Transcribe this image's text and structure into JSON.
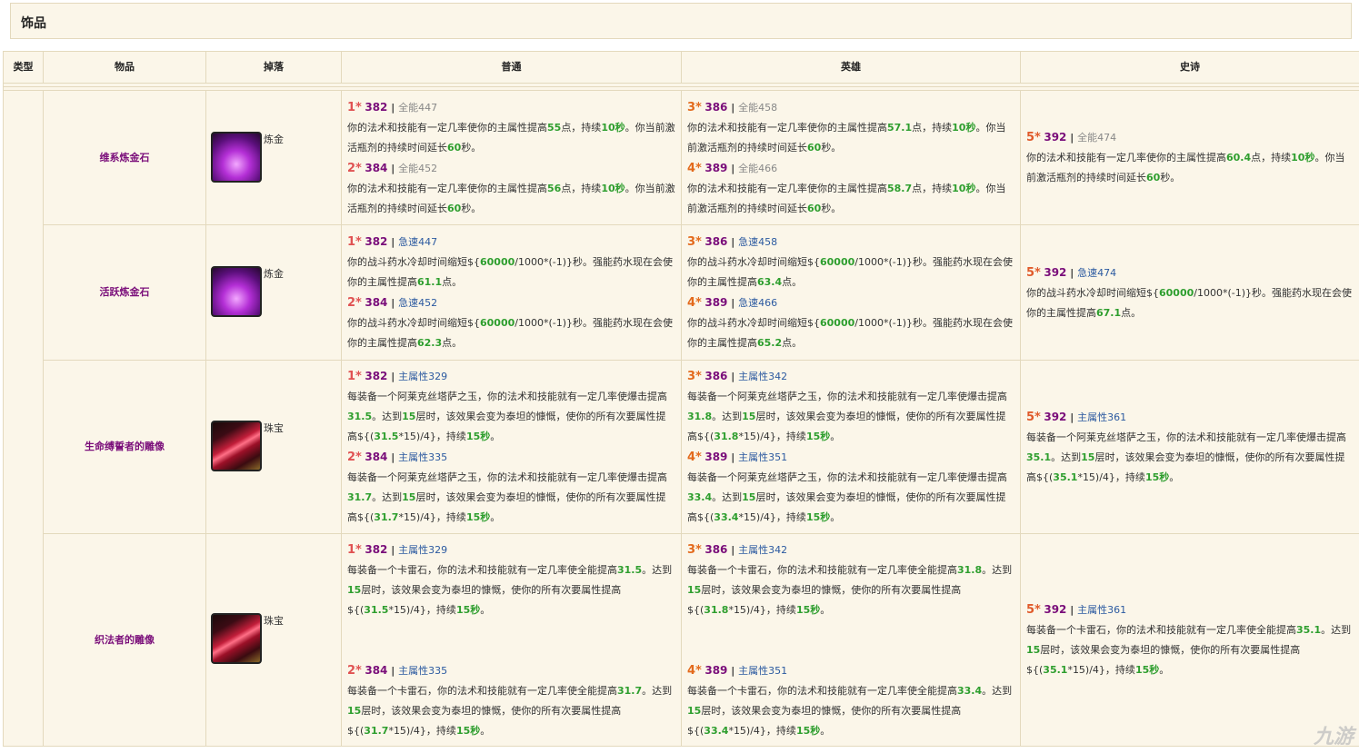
{
  "title": "饰品",
  "headers": [
    "类型",
    "物品",
    "掉落",
    "普通",
    "英雄",
    "史诗"
  ],
  "rows": [
    {
      "item": "维系炼金石",
      "icon": "purple-potion-icon",
      "drop": "炼金",
      "normal": [
        {
          "star": "1*",
          "ilvl": "382",
          "stat": "全能447",
          "desc": [
            "你的法术和技能有一定几率使你的主属性提高",
            "55",
            "点，持续",
            "10秒",
            "。你当前激活瓶剂的持续时间延长",
            "60",
            "秒。"
          ]
        },
        {
          "star": "2*",
          "ilvl": "384",
          "stat": "全能452",
          "desc": [
            "你的法术和技能有一定几率使你的主属性提高",
            "56",
            "点，持续",
            "10秒",
            "。你当前激活瓶剂的持续时间延长",
            "60",
            "秒。"
          ]
        }
      ],
      "heroic": [
        {
          "star": "3*",
          "ilvl": "386",
          "stat": "全能458",
          "desc": [
            "你的法术和技能有一定几率使你的主属性提高",
            "57.1",
            "点，持续",
            "10秒",
            "。你当前激活瓶剂的持续时间延长",
            "60",
            "秒。"
          ]
        },
        {
          "star": "4*",
          "ilvl": "389",
          "stat": "全能466",
          "desc": [
            "你的法术和技能有一定几率使你的主属性提高",
            "58.7",
            "点，持续",
            "10秒",
            "。你当前激活瓶剂的持续时间延长",
            "60",
            "秒。"
          ]
        }
      ],
      "epic": [
        {
          "star": "5*",
          "ilvl": "392",
          "stat": "全能474",
          "desc": [
            "你的法术和技能有一定几率使你的主属性提高",
            "60.4",
            "点，持续",
            "10秒",
            "。你当前激活瓶剂的持续时间延长",
            "60",
            "秒。"
          ]
        }
      ]
    },
    {
      "item": "活跃炼金石",
      "icon": "purple-potion-icon",
      "drop": "炼金",
      "normal": [
        {
          "star": "1*",
          "ilvl": "382",
          "stat": "急速447",
          "formula": "60000",
          "formula_tail": "/1000*(-1)}秒。强能药水现在会使你的主属性提高",
          "value": "61.1"
        },
        {
          "star": "2*",
          "ilvl": "384",
          "stat": "急速452",
          "formula": "60000",
          "formula_tail": "/1000*(-1)}秒。强能药水现在会使你的主属性提高",
          "value": "62.3"
        }
      ],
      "heroic": [
        {
          "star": "3*",
          "ilvl": "386",
          "stat": "急速458",
          "formula": "60000",
          "formula_tail": "/1000*(-1)}秒。强能药水现在会使你的主属性提高",
          "value": "63.4"
        },
        {
          "star": "4*",
          "ilvl": "389",
          "stat": "急速466",
          "formula": "60000",
          "formula_tail": "/1000*(-1)}秒。强能药水现在会使你的主属性提高",
          "value": "65.2"
        }
      ],
      "epic": [
        {
          "star": "5*",
          "ilvl": "392",
          "stat": "急速474",
          "formula": "60000",
          "formula_tail": "/1000*(-1)}秒。强能药水现在会使你的主属性提高",
          "value": "67.1"
        }
      ],
      "desc_head": "你的战斗药水冷却时间缩短${",
      "desc_end": "点。"
    },
    {
      "item": "生命缚誓者的雕像",
      "icon": "red-gem-icon",
      "drop": "珠宝",
      "normal": [
        {
          "star": "1*",
          "ilvl": "382",
          "stat": "主属性329",
          "a": "31.5",
          "b": "15",
          "c": "31.5",
          "d": "15秒"
        },
        {
          "star": "2*",
          "ilvl": "384",
          "stat": "主属性335",
          "a": "31.7",
          "b": "15",
          "c": "31.7",
          "d": "15秒"
        }
      ],
      "heroic": [
        {
          "star": "3*",
          "ilvl": "386",
          "stat": "主属性342",
          "a": "31.8",
          "b": "15",
          "c": "31.8",
          "d": "15秒"
        },
        {
          "star": "4*",
          "ilvl": "389",
          "stat": "主属性351",
          "a": "33.4",
          "b": "15",
          "c": "33.4",
          "d": "15秒"
        }
      ],
      "epic": [
        {
          "star": "5*",
          "ilvl": "392",
          "stat": "主属性361",
          "a": "35.1",
          "b": "15",
          "c": "35.1",
          "d": "15秒"
        }
      ]
    },
    {
      "item": "织法者的雕像",
      "icon": "red-gem-icon",
      "drop": "珠宝",
      "normal": [
        {
          "star": "1*",
          "ilvl": "382",
          "stat": "主属性329",
          "a": "31.5",
          "b": "15",
          "c": "31.5",
          "d": "15秒"
        },
        {
          "star": "2*",
          "ilvl": "384",
          "stat": "主属性335",
          "a": "31.7",
          "b": "15",
          "c": "31.7",
          "d": "15秒"
        }
      ],
      "heroic": [
        {
          "star": "3*",
          "ilvl": "386",
          "stat": "主属性342",
          "a": "31.8",
          "b": "15",
          "c": "31.8",
          "d": "15秒"
        },
        {
          "star": "4*",
          "ilvl": "389",
          "stat": "主属性351",
          "a": "33.4",
          "b": "15",
          "c": "33.4",
          "d": "15秒"
        }
      ],
      "epic": [
        {
          "star": "5*",
          "ilvl": "392",
          "stat": "主属性361",
          "a": "35.1",
          "b": "15",
          "c": "35.1",
          "d": "15秒"
        }
      ]
    }
  ],
  "text": {
    "statue1_p1": "每装备一个阿莱克丝塔萨之玉，你的法术和技能就有一定几率使爆击提高",
    "statue1_p2": "。达到",
    "statue1_p3": "层时，该效果会变为泰坦的慷慨，使你的所有次要属性提高${(",
    "statue1_p4": "*15)/4}，持续",
    "statue1_p5": "。",
    "statue2_p1": "每装备一个卡雷石，你的法术和技能就有一定几率使全能提高",
    "statue2_p2": "。达到",
    "statue2_p3": "层时，该效果会变为泰坦的慷慨，使你的所有次要属性提高${(",
    "statue2_p4": "*15)/4}，持续",
    "statue2_p5": "。"
  },
  "watermark": "九游",
  "colors": {
    "background": "#fbf6e9",
    "border": "#e3d9bd",
    "item_name": "#7a0e7a",
    "number_green": "#2e9e2e",
    "stat_blue": "#2c5aa0"
  }
}
